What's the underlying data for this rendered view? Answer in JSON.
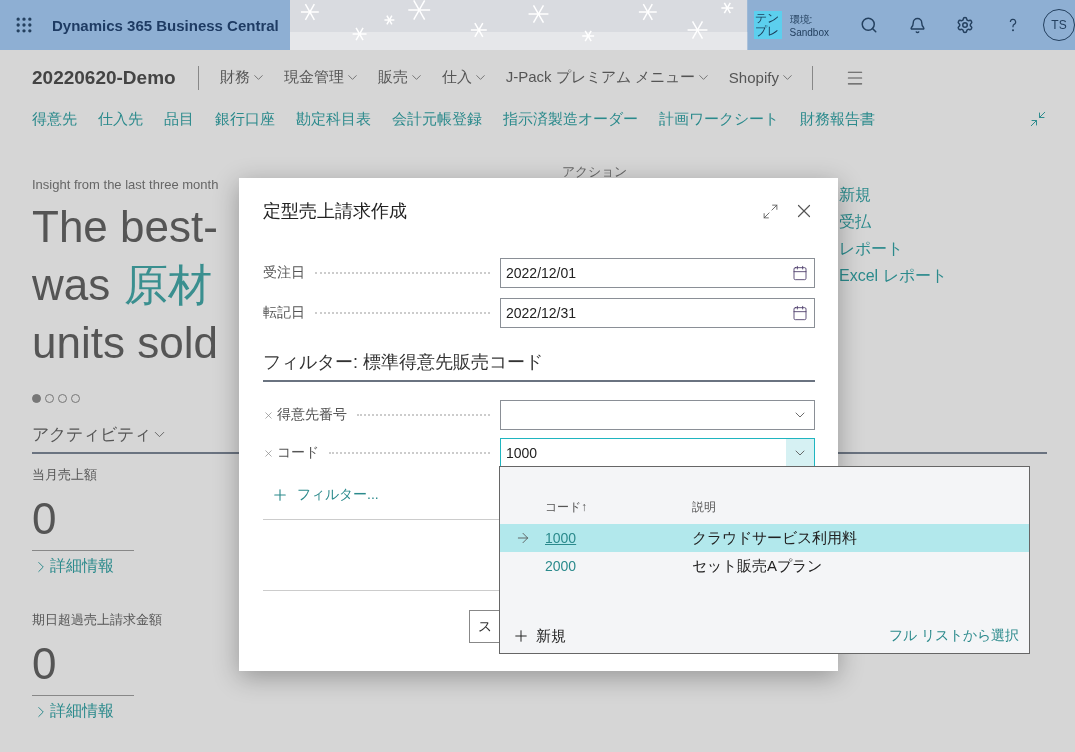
{
  "top_bar": {
    "app_title": "Dynamics 365 Business Central",
    "environment_badge": "テンプレ",
    "environment_label": "環境:",
    "environment_name": "Sandbox",
    "avatar": "TS"
  },
  "nav": {
    "company": "20220620-Demo",
    "menus": [
      "財務",
      "現金管理",
      "販売",
      "仕入",
      "J-Pack プレミアム メニュー",
      "Shopify"
    ]
  },
  "links": [
    "得意先",
    "仕入先",
    "品目",
    "銀行口座",
    "勘定科目表",
    "会計元帳登録",
    "指示済製造オーダー",
    "計画ワークシート",
    "財務報告書"
  ],
  "headline": {
    "caption": "Insight from the last three month",
    "line1": "The best-",
    "line2_prefix": "was",
    "line2_highlight": "原材",
    "line3": "units sold"
  },
  "carousel": [
    {
      "selected": true
    },
    {
      "selected": false
    },
    {
      "selected": false
    },
    {
      "selected": false
    }
  ],
  "activities": {
    "title": "アクティビティ",
    "tiles": [
      {
        "label": "当月売上額",
        "value": "0",
        "link": "詳細情報"
      },
      {
        "label": "期日超過売上請求金額",
        "value": "0",
        "link": "詳細情報"
      }
    ]
  },
  "actions": {
    "title": "アクション",
    "items": [
      "新規",
      "受払",
      "レポート",
      "Excel レポート"
    ]
  },
  "dialog": {
    "title": "定型売上請求作成",
    "fields": [
      {
        "label": "受注日",
        "value": "2022/12/01"
      },
      {
        "label": "転記日",
        "value": "2022/12/31"
      }
    ],
    "filter_title": "フィルター: 標準得意先販売コード",
    "filters": [
      {
        "label": "得意先番号",
        "focused": false
      },
      {
        "label": "コード",
        "value": "1000",
        "focused": true
      }
    ],
    "add_filter": "フィルター...",
    "buttons": [
      "ス"
    ]
  },
  "lookup": {
    "columns": [
      "コード↑",
      "説明"
    ],
    "rows": [
      {
        "code": "1000",
        "description": "クラウドサービス利用料",
        "selected": true
      },
      {
        "code": "2000",
        "description": "セット販売Aプラン",
        "selected": false
      }
    ],
    "new": "新規",
    "full_list": "フル リストから選択"
  }
}
